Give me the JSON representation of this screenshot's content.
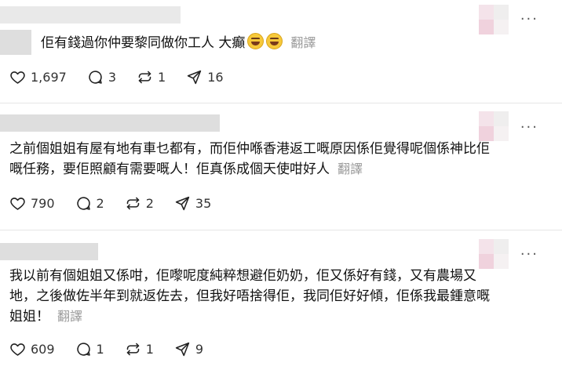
{
  "posts": [
    {
      "text": "佢有錢過你仲要黎同做你工人 大癲",
      "emojis": [
        "grin-sweat-emoji",
        "grin-sweat-emoji"
      ],
      "translate": "翻譯",
      "likes": "1,697",
      "replies": "3",
      "reposts": "1",
      "shares": "16"
    },
    {
      "lines": [
        "之前個姐姐有屋有地有車乜都有，而佢仲喺香港返工嘅原因係佢覺得呢個係神比佢",
        "嘅任務，要佢照顧有需要嘅人！佢真係成個天使咁好人"
      ],
      "translate": "翻譯",
      "likes": "790",
      "replies": "2",
      "reposts": "2",
      "shares": "35"
    },
    {
      "lines": [
        "我以前有個姐姐又係咁，佢嚟呢度純粹想避佢奶奶，佢又係好有錢，又有農場又",
        "地，之後做佐半年到就返佐去，但我好唔捨得佢，我同佢好好傾，佢係我最鍾意嘅",
        "姐姐！"
      ],
      "translate": "翻譯",
      "likes": "609",
      "replies": "1",
      "reposts": "1",
      "shares": "9"
    }
  ],
  "more_label": "···",
  "icons": {
    "like": "heart-icon",
    "reply": "comment-icon",
    "repost": "repost-icon",
    "share": "send-icon"
  }
}
